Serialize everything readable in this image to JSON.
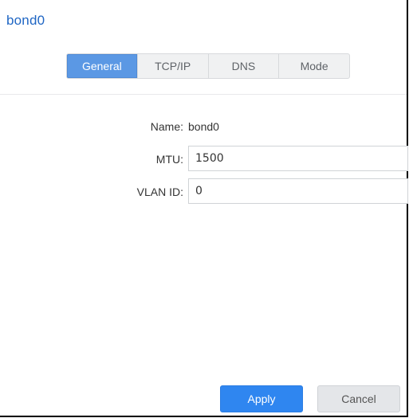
{
  "dialog": {
    "title": "bond0"
  },
  "tabs": [
    {
      "label": "General",
      "active": true
    },
    {
      "label": "TCP/IP",
      "active": false
    },
    {
      "label": "DNS",
      "active": false
    },
    {
      "label": "Mode",
      "active": false
    }
  ],
  "general": {
    "name_label": "Name:",
    "name_value": "bond0",
    "mtu_label": "MTU:",
    "mtu_value": "1500",
    "vlan_label": "VLAN ID:",
    "vlan_value": "0"
  },
  "buttons": {
    "apply": "Apply",
    "cancel": "Cancel"
  },
  "colors": {
    "title": "#1f66c4",
    "active_tab": "#5b98e4",
    "apply_button": "#2f86f0",
    "cancel_button": "#e4e6e9"
  }
}
